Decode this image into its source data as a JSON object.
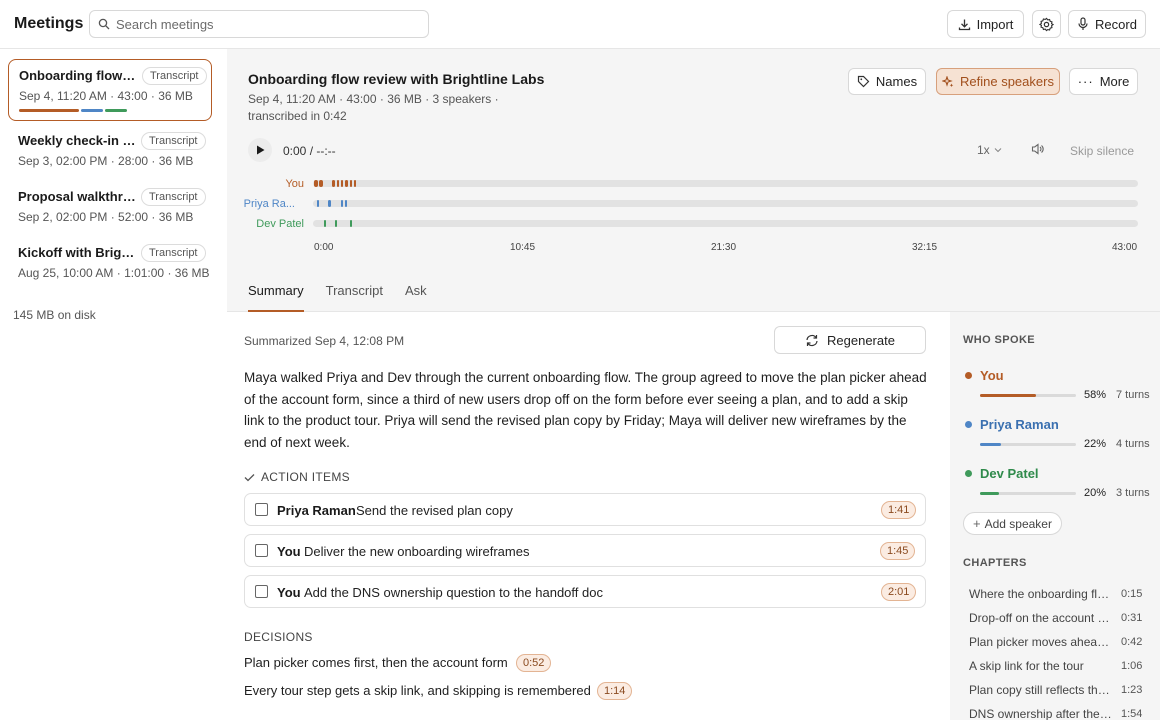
{
  "app": {
    "title": "Meetings"
  },
  "search": {
    "placeholder": "Search meetings"
  },
  "toolbar": {
    "import_label": "Import",
    "record_label": "Record"
  },
  "meetings": [
    {
      "title": "Onboarding flow review with Brightline Labs",
      "tag": "Transcript",
      "meta": "Sep 4, 11:20 AM · 43:00 · 36 MB"
    },
    {
      "title": "Weekly check-in with Brightline Labs",
      "tag": "Transcript",
      "meta": "Sep 3, 02:00 PM · 28:00 · 36 MB"
    },
    {
      "title": "Proposal walkthrough",
      "tag": "Transcript",
      "meta": "Sep 2, 02:00 PM · 52:00 · 36 MB"
    },
    {
      "title": "Kickoff with Brightline Labs",
      "tag": "Transcript",
      "meta": "Aug 25, 10:00 AM · 1:01:00 · 36 MB"
    }
  ],
  "disk_usage": "145 MB on disk",
  "meeting": {
    "title": "Onboarding flow review with Brightline Labs",
    "meta": "Sep 4, 11:20 AM · 43:00 · 36 MB · 3 speakers ·",
    "meta2": "transcribed in 0:42",
    "names_label": "Names",
    "refine_label": "Refine speakers",
    "more_label": "More"
  },
  "player": {
    "time": "0:00 / --:--",
    "speed": "1x",
    "skip_silence": "Skip silence",
    "ticks": [
      "0:00",
      "10:45",
      "21:30",
      "32:15",
      "43:00"
    ]
  },
  "lanes": [
    {
      "label": "You",
      "color": "#b45c26"
    },
    {
      "label": "Priya Ra...",
      "color": "#4f86c6"
    },
    {
      "label": "Dev Patel",
      "color": "#3f9a5b"
    }
  ],
  "tabs": [
    "Summary",
    "Transcript",
    "Ask"
  ],
  "summary": {
    "summarized": "Summarized Sep 4, 12:08 PM",
    "regenerate_label": "Regenerate",
    "text": "Maya walked Priya and Dev through the current onboarding flow. The group agreed to move the plan picker ahead of the account form, since a third of new users drop off on the form before ever seeing a plan, and to add a skip link to the product tour. Priya will send the revised plan copy by Friday; Maya will deliver new wireframes by the end of next week.",
    "action_items_heading": "ACTION ITEMS",
    "action_items": [
      {
        "who": "Priya Raman",
        "what": "Send the revised plan copy",
        "time": "1:41"
      },
      {
        "who": "You",
        "what": "Deliver the new onboarding wireframes",
        "time": "1:45"
      },
      {
        "who": "You",
        "what": "Add the DNS ownership question to the handoff doc",
        "time": "2:01"
      }
    ],
    "decisions_heading": "DECISIONS",
    "decisions": [
      {
        "text": "Plan picker comes first, then the account form",
        "time": "0:52"
      },
      {
        "text": "Every tour step gets a skip link, and skipping is remembered",
        "time": "1:14"
      }
    ]
  },
  "who_spoke": {
    "heading": "WHO SPOKE",
    "speakers": [
      {
        "name": "You",
        "pct_label": "58%",
        "pct": 0.58,
        "turns": "7 turns",
        "color": "#b45c26"
      },
      {
        "name": "Priya Raman",
        "pct_label": "22%",
        "pct": 0.22,
        "turns": "4 turns",
        "color": "#4f86c6"
      },
      {
        "name": "Dev Patel",
        "pct_label": "20%",
        "pct": 0.2,
        "turns": "3 turns",
        "color": "#3f9a5b"
      }
    ],
    "add_label": "Add speaker"
  },
  "chapters": {
    "heading": "CHAPTERS",
    "items": [
      {
        "title": "Where the onboarding flow loses people",
        "time": "0:15"
      },
      {
        "title": "Drop-off on the account form",
        "time": "0:31"
      },
      {
        "title": "Plan picker moves ahead of the form",
        "time": "0:42"
      },
      {
        "title": "A skip link for the tour",
        "time": "1:06"
      },
      {
        "title": "Plan copy still reflects the old tiers",
        "time": "1:23"
      },
      {
        "title": "DNS ownership after the handoff",
        "time": "1:54"
      }
    ]
  }
}
